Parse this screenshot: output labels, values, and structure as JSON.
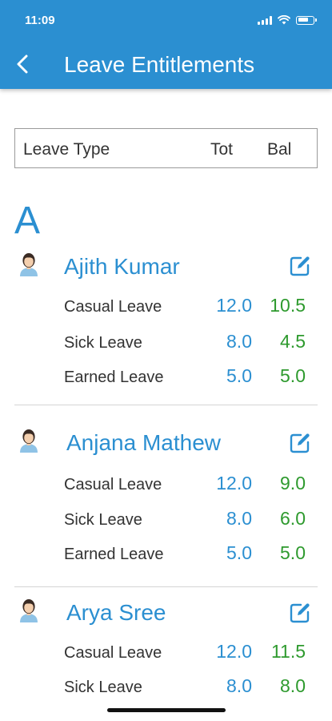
{
  "status_bar": {
    "time": "11:09"
  },
  "header": {
    "title": "Leave Entitlements",
    "back_icon": "chevron-left-icon"
  },
  "table_header": {
    "type": "Leave Type",
    "tot": "Tot",
    "bal": "Bal"
  },
  "section": {
    "letter": "A"
  },
  "colors": {
    "primary": "#2b8fd1",
    "balance": "#2e9a2e",
    "text": "#333333"
  },
  "employees": [
    {
      "name": "Ajith Kumar",
      "leaves": [
        {
          "type": "Casual Leave",
          "tot": "12.0",
          "bal": "10.5"
        },
        {
          "type": "Sick Leave",
          "tot": "8.0",
          "bal": "4.5"
        },
        {
          "type": "Earned Leave",
          "tot": "5.0",
          "bal": "5.0"
        }
      ]
    },
    {
      "name": "Anjana Mathew",
      "leaves": [
        {
          "type": "Casual Leave",
          "tot": "12.0",
          "bal": "9.0"
        },
        {
          "type": "Sick Leave",
          "tot": "8.0",
          "bal": "6.0"
        },
        {
          "type": "Earned Leave",
          "tot": "5.0",
          "bal": "5.0"
        }
      ]
    },
    {
      "name": "Arya Sree",
      "leaves": [
        {
          "type": "Casual Leave",
          "tot": "12.0",
          "bal": "11.5"
        },
        {
          "type": "Sick Leave",
          "tot": "8.0",
          "bal": "8.0"
        }
      ]
    }
  ]
}
